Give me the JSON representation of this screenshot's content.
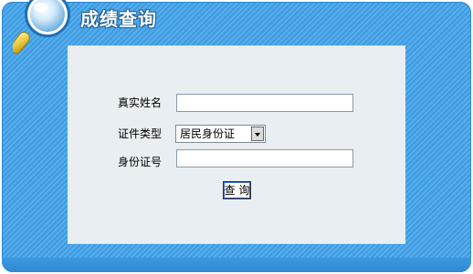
{
  "header": {
    "title": "成绩查询"
  },
  "form": {
    "name_label": "真实姓名",
    "name_value": "",
    "id_type_label": "证件类型",
    "id_type_selected": "居民身份证",
    "id_number_label": "身份证号",
    "id_number_value": "",
    "submit_label": "查 询"
  },
  "colors": {
    "panel": "#3f9be0",
    "form_bg": "#e8eef1"
  }
}
